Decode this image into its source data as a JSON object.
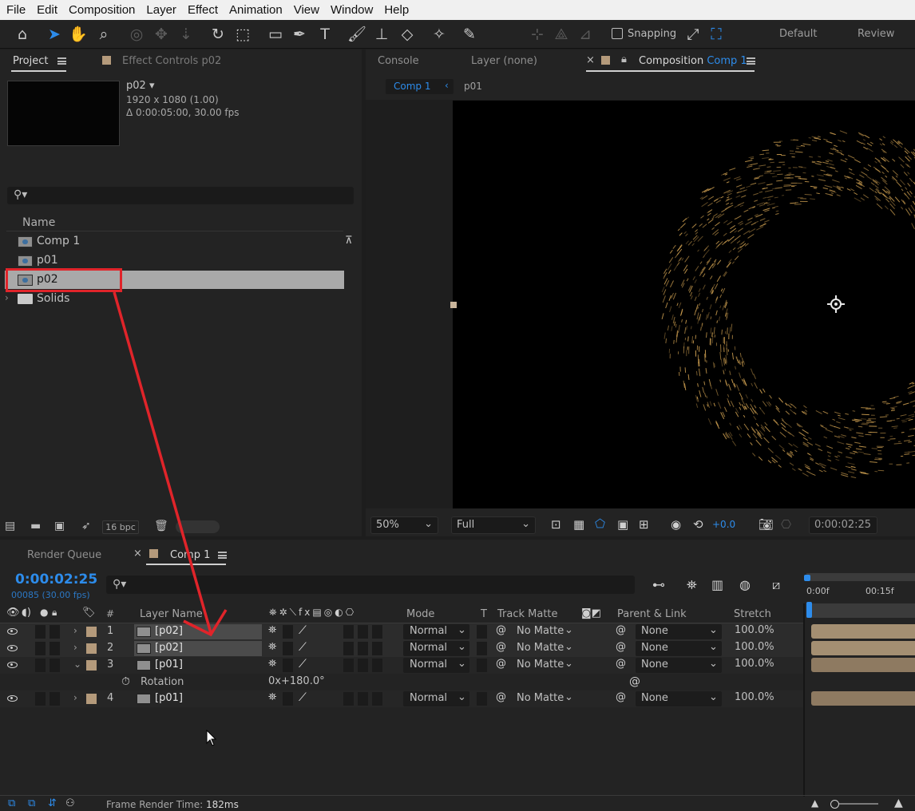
{
  "menu": [
    "File",
    "Edit",
    "Composition",
    "Layer",
    "Effect",
    "Animation",
    "View",
    "Window",
    "Help"
  ],
  "toolbar": {
    "snapping_label": "Snapping",
    "workspaces": [
      "Default",
      "Review"
    ]
  },
  "project_panel": {
    "tab_project": "Project",
    "tab_effect_controls": "Effect Controls p02",
    "item_name": "p02",
    "item_dims": "1920 x 1080 (1.00)",
    "item_duration": "Δ 0:00:05:00, 30.00 fps",
    "search_placeholder": "",
    "column_name": "Name",
    "items": [
      {
        "label": "Comp 1",
        "type": "composition"
      },
      {
        "label": "p01",
        "type": "composition"
      },
      {
        "label": "p02",
        "type": "composition",
        "selected": true
      },
      {
        "label": "Solids",
        "type": "folder"
      }
    ],
    "bpc": "16 bpc"
  },
  "viewer_panel": {
    "tab_console": "Console",
    "tab_layer": "Layer (none)",
    "tab_composition": "Composition",
    "tab_composition_name": "Comp 1",
    "breadcrumb_active": "Comp 1",
    "breadcrumb_next": "p01",
    "zoom": "50%",
    "resolution": "Full",
    "exposure": "+0.0",
    "timecode": "0:00:02:25"
  },
  "timeline_panel": {
    "tab_render_queue": "Render Queue",
    "tab_comp": "Comp 1",
    "current_time": "0:00:02:25",
    "frame_info": "00085 (30.00 fps)",
    "ruler_labels": [
      "0:00f",
      "00:15f"
    ],
    "headers": {
      "num": "#",
      "layer_name": "Layer Name",
      "mode": "Mode",
      "t": "T",
      "track_matte": "Track Matte",
      "parent_link": "Parent & Link",
      "stretch": "Stretch"
    },
    "layers": [
      {
        "num": "1",
        "name": "[p02]",
        "mode": "Normal",
        "matte": "No Matte",
        "parent": "None",
        "stretch": "100.0%",
        "expanded": false
      },
      {
        "num": "2",
        "name": "[p02]",
        "mode": "Normal",
        "matte": "No Matte",
        "parent": "None",
        "stretch": "100.0%",
        "expanded": false
      },
      {
        "num": "3",
        "name": "[p01]",
        "mode": "Normal",
        "matte": "No Matte",
        "parent": "None",
        "stretch": "100.0%",
        "expanded": true
      },
      {
        "num": "4",
        "name": "[p01]",
        "mode": "Normal",
        "matte": "No Matte",
        "parent": "None",
        "stretch": "100.0%",
        "expanded": false
      }
    ],
    "property": {
      "label": "Rotation",
      "value_revs": "0",
      "value_deg": "+180.0°"
    },
    "footer_label": "Frame Render Time:",
    "footer_value": "182ms"
  },
  "colors": {
    "accent": "#2d8ceb",
    "annotation": "#e0242a",
    "label_swatch": "#b49a7b",
    "particles": "#c79a4e"
  }
}
